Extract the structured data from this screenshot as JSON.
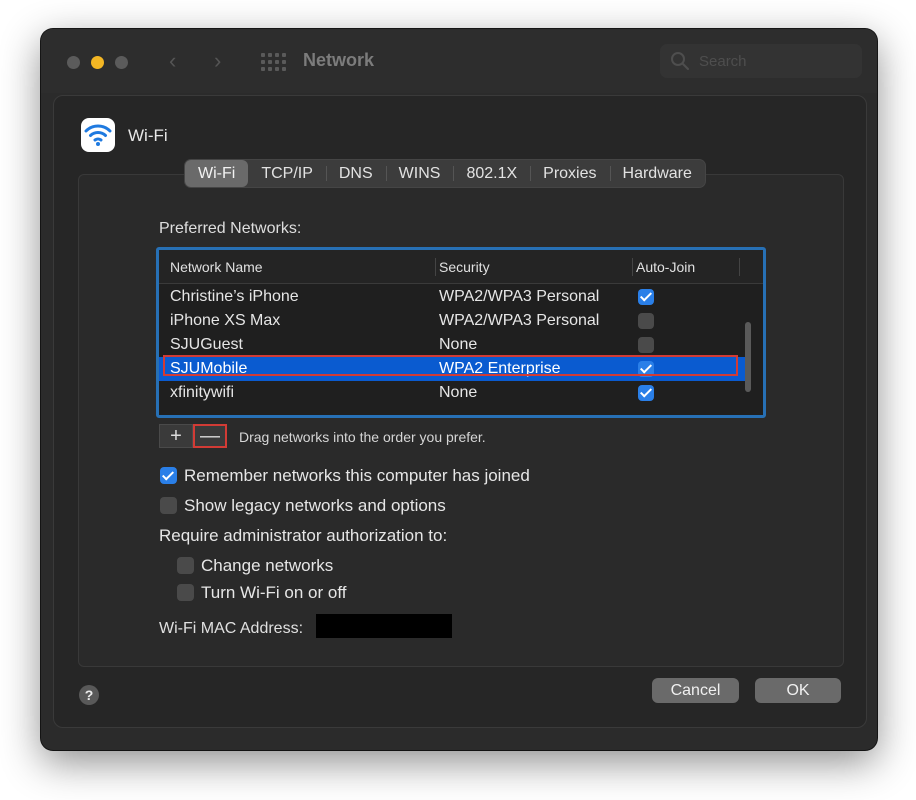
{
  "window": {
    "title": "Network",
    "search_placeholder": "Search"
  },
  "sheet": {
    "title": "Wi-Fi",
    "tabs": [
      {
        "label": "Wi-Fi",
        "active": true
      },
      {
        "label": "TCP/IP",
        "active": false
      },
      {
        "label": "DNS",
        "active": false
      },
      {
        "label": "WINS",
        "active": false
      },
      {
        "label": "802.1X",
        "active": false
      },
      {
        "label": "Proxies",
        "active": false
      },
      {
        "label": "Hardware",
        "active": false
      }
    ],
    "preferred_label": "Preferred Networks:",
    "table": {
      "headers": {
        "name": "Network Name",
        "security": "Security",
        "autojoin": "Auto-Join"
      },
      "rows": [
        {
          "name": "Christine’s iPhone",
          "security": "WPA2/WPA3 Personal",
          "auto_join": true
        },
        {
          "name": "iPhone XS Max",
          "security": "WPA2/WPA3 Personal",
          "auto_join": false
        },
        {
          "name": "SJUGuest",
          "security": "None",
          "auto_join": false
        },
        {
          "name": "SJUMobile",
          "security": "WPA2 Enterprise",
          "auto_join": true,
          "selected": true
        },
        {
          "name": "xfinitywifi",
          "security": "None",
          "auto_join": true
        }
      ]
    },
    "add_label": "+",
    "remove_label": "—",
    "drag_hint": "Drag networks into the order you prefer.",
    "options": {
      "remember": {
        "label": "Remember networks this computer has joined",
        "checked": true
      },
      "legacy": {
        "label": "Show legacy networks and options",
        "checked": false
      },
      "require_admin": "Require administrator authorization to:",
      "change_networks": {
        "label": "Change networks",
        "checked": false
      },
      "turn_wifi": {
        "label": "Turn Wi-Fi on or off",
        "checked": false
      }
    },
    "mac_label": "Wi-Fi MAC Address:",
    "help_label": "?",
    "cancel_label": "Cancel",
    "ok_label": "OK"
  },
  "colors": {
    "accent": "#2a7fe8",
    "selection": "#0a5bd0",
    "highlight_outline": "#d23b35",
    "table_focus": "#2770b5"
  }
}
